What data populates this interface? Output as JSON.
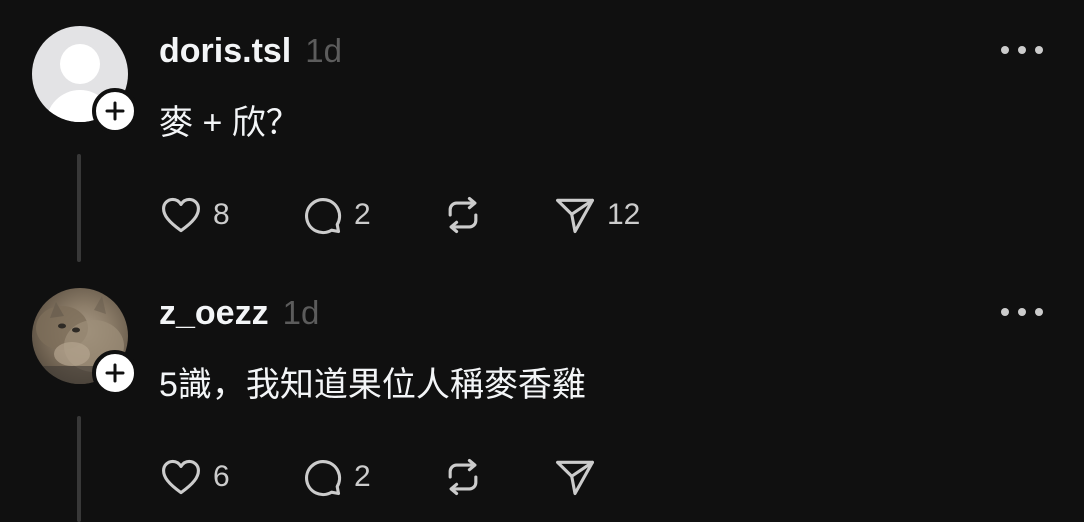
{
  "colors": {
    "background": "#101010",
    "text_primary": "#f3f5f7",
    "text_secondary": "#5c5c5c",
    "icon": "#cccccc",
    "thread_line": "#383838"
  },
  "posts": [
    {
      "username": "doris.tsl",
      "timestamp": "1d",
      "text": "麥 + 欣？",
      "avatar": "default-avatar-icon",
      "likes": "8",
      "replies": "2",
      "shares": "12"
    },
    {
      "username": "z_oezz",
      "timestamp": "1d",
      "text": "5識，我知道果位人稱麥香雞",
      "avatar": "cat-photo-avatar",
      "likes": "6",
      "replies": "2",
      "shares": ""
    }
  ],
  "icons": {
    "follow": "plus-icon",
    "more": "more-horizontal-icon",
    "like": "heart-icon",
    "reply": "comment-icon",
    "repost": "repost-icon",
    "share": "send-icon"
  }
}
